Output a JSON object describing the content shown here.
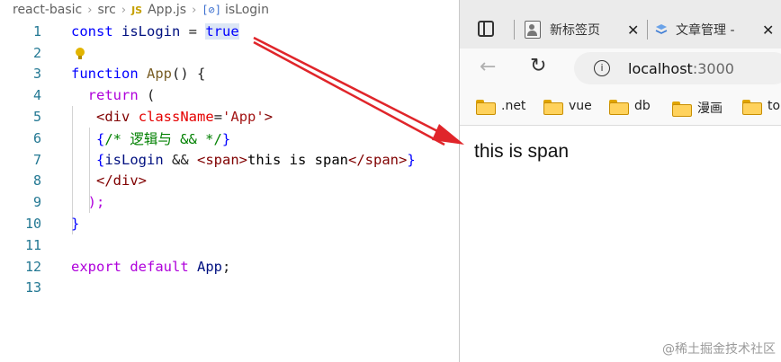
{
  "editor": {
    "breadcrumb": {
      "folder": "react-basic",
      "subfolder": "src",
      "js_badge": "JS",
      "file": "App.js",
      "symbol_icon": "[⊘]",
      "symbol": "isLogin"
    },
    "line_numbers": [
      "1",
      "2",
      "3",
      "4",
      "5",
      "6",
      "7",
      "8",
      "9",
      "10",
      "11",
      "12",
      "13"
    ],
    "code": {
      "l1": {
        "kw": "const",
        "var": "isLogin",
        "op": " = ",
        "val": "true"
      },
      "l3": {
        "kw": "function",
        "fn": "App",
        "rest": "() {"
      },
      "l4": {
        "kw": "return",
        "rest": " ("
      },
      "l5": {
        "open": "<",
        "tag": "div",
        "attr": "className",
        "eq": "=",
        "str": "'App'",
        "close": ">"
      },
      "l6": {
        "brace_open": "{",
        "comment": "/* 逻辑与 && */",
        "brace_close": "}"
      },
      "l7": {
        "brace_open": "{",
        "var": "isLogin",
        "op": " && ",
        "tag_open_lt": "<",
        "tag_open": "span",
        "tag_open_gt": ">",
        "text": "this is span",
        "tag_close_lt": "</",
        "tag_close": "span",
        "tag_close_gt": ">",
        "brace_close": "}"
      },
      "l8": {
        "lt": "</",
        "tag": "div",
        "gt": ">"
      },
      "l9": {
        "text": ");"
      },
      "l10": {
        "text": "}"
      },
      "l12": {
        "kw1": "export",
        "kw2": "default",
        "var": "App",
        "end": ";"
      }
    }
  },
  "browser": {
    "tabs": [
      {
        "label": "新标签页",
        "icon": "new-tab-page-icon"
      },
      {
        "label": "文章管理 -",
        "icon": "document-logo-icon"
      }
    ],
    "url_host": "localhost",
    "url_port": ":3000",
    "bookmarks": [
      ".net",
      "vue",
      "db",
      "漫画",
      "to"
    ],
    "page_text": "this is span"
  },
  "watermark": "@稀土掘金技术社区",
  "colors": {
    "arrow": "#e0252a",
    "keyword": "#0000ff",
    "line_number": "#237893",
    "comment": "#008000",
    "tag": "#800000"
  }
}
